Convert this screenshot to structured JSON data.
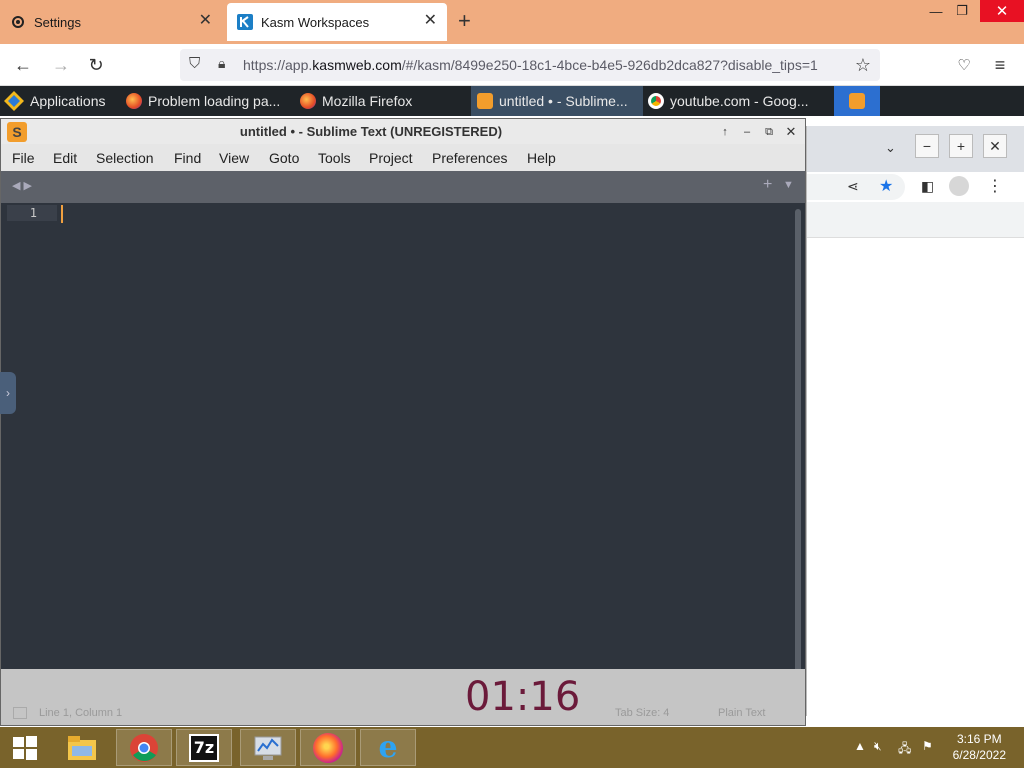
{
  "browser": {
    "tabs": [
      {
        "label": "Settings",
        "icon": "gear-icon",
        "active": false
      },
      {
        "label": "Kasm Workspaces",
        "icon": "kasm-logo-icon",
        "active": true
      }
    ],
    "new_tab_label": "+",
    "url_prefix": "https://app.",
    "url_domain": "kasmweb.com",
    "url_suffix": "/#/kasm/8499e250-18c1-4bce-b4e5-926db2dca827?disable_tips=1"
  },
  "xfce_panel": {
    "applications_label": "Applications",
    "tasks": [
      {
        "label": "Problem loading pa...",
        "icon": "firefox-icon"
      },
      {
        "label": "Mozilla Firefox",
        "icon": "firefox-icon"
      },
      {
        "label": "untitled • - Sublime...",
        "icon": "sublime-icon"
      },
      {
        "label": "youtube.com - Goog...",
        "icon": "chrome-icon"
      }
    ]
  },
  "sublime": {
    "title": "untitled • - Sublime Text (UNREGISTERED)",
    "menu": [
      "File",
      "Edit",
      "Selection",
      "Find",
      "View",
      "Goto",
      "Tools",
      "Project",
      "Preferences",
      "Help"
    ],
    "line_number": "1",
    "status_left": "Line 1, Column 1",
    "status_tab_size": "Tab Size: 4",
    "status_syntax": "Plain Text"
  },
  "session_timer": "01:16",
  "taskbar": {
    "apps": [
      "windows-start-icon",
      "file-explorer-icon",
      "chrome-icon",
      "7zip-icon",
      "network-monitor-icon",
      "firefox-icon",
      "internet-explorer-icon"
    ],
    "time": "3:16 PM",
    "date": "6/28/2022"
  },
  "colors": {
    "browser_tabbar": "#f0ac80",
    "sublime_editor_bg": "#2e343d",
    "caret": "#f0a040",
    "timer": "#6b1a3a",
    "taskbar": "#79632b"
  }
}
